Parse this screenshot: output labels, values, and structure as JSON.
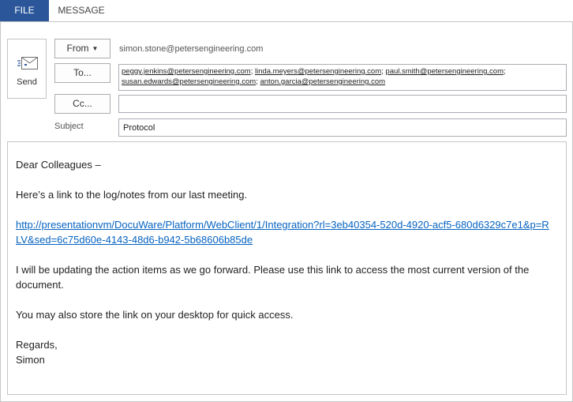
{
  "ribbon": {
    "tabs": [
      {
        "label": "FILE"
      },
      {
        "label": "MESSAGE"
      }
    ]
  },
  "send": {
    "label": "Send"
  },
  "from": {
    "button": "From",
    "address": "simon.stone@petersengineering.com"
  },
  "to": {
    "button": "To...",
    "recipients": [
      "peggy.jenkins@petersengineering.com",
      "linda.meyers@petersengineering.com",
      "paul.smith@petersengineering.com",
      "susan.edwards@petersengineering.com",
      "anton.garcia@petersengineering.com"
    ],
    "separator": ";"
  },
  "cc": {
    "button": "Cc...",
    "value": ""
  },
  "subject": {
    "label": "Subject",
    "value": "Protocol"
  },
  "body": {
    "greeting": "Dear Colleagues –",
    "para1": "Here’s a link to the log/notes from our last meeting.",
    "link": "http://presentationvm/DocuWare/Platform/WebClient/1/Integration?rl=3eb40354-520d-4920-acf5-680d6329c7e1&p=RLV&sed=6c75d60e-4143-48d6-b942-5b68606b85de",
    "para2": "I will be updating the action items as we go forward. Please use this link to access the most current version of the document.",
    "para3": "You may also store the link on your desktop for quick access.",
    "closing": "Regards,",
    "signature": "Simon"
  },
  "colors": {
    "accent": "#2b579a",
    "link": "#0563c1"
  }
}
